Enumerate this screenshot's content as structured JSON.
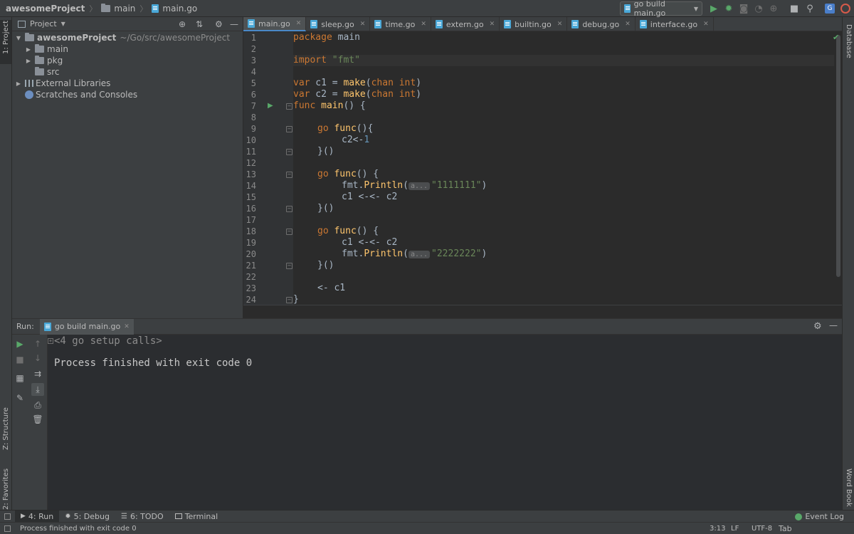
{
  "navbar": {
    "project": "awesomeProject",
    "folder": "main",
    "file": "main.go"
  },
  "run_config": {
    "label": "go build main.go"
  },
  "left_stripe": {
    "project_label": "1: Project",
    "structure_label": "Z: Structure",
    "favorites_label": "2: Favorites"
  },
  "right_stripe": {
    "database_label": "Database",
    "wordbook_label": "Word Book"
  },
  "project_panel": {
    "title": "Project",
    "tree": [
      {
        "label": "awesomeProject",
        "path": "~/Go/src/awesomeProject"
      },
      {
        "label": "main"
      },
      {
        "label": "pkg"
      },
      {
        "label": "src"
      },
      {
        "label": "External Libraries"
      },
      {
        "label": "Scratches and Consoles"
      }
    ]
  },
  "editor": {
    "tabs": [
      {
        "label": "main.go"
      },
      {
        "label": "sleep.go"
      },
      {
        "label": "time.go"
      },
      {
        "label": "extern.go"
      },
      {
        "label": "builtin.go"
      },
      {
        "label": "debug.go"
      },
      {
        "label": "interface.go"
      }
    ],
    "line_numbers": [
      "1",
      "2",
      "3",
      "4",
      "5",
      "6",
      "7",
      "8",
      "9",
      "10",
      "11",
      "12",
      "13",
      "14",
      "15",
      "16",
      "17",
      "18",
      "19",
      "20",
      "21",
      "22",
      "23",
      "24"
    ],
    "code": {
      "l1_kw": "package",
      "l1_rest": " main",
      "l3_kw": "import",
      "l3_str": "\"fmt\"",
      "l5_kw": "var",
      "l5_a": " c1 = ",
      "l5_fn": "make",
      "l5_b": "(",
      "l5_chan": "chan",
      "l5_int": " int",
      "l5_c": ")",
      "l6_kw": "var",
      "l6_a": " c2 = ",
      "l6_fn": "make",
      "l6_b": "(",
      "l6_chan": "chan",
      "l6_int": " int",
      "l6_c": ")",
      "l7_kw": "func",
      "l7_fn": " main",
      "l7_rest": "() {",
      "l9_kw": "go",
      "l9_fn": " func",
      "l9_rest": "(){",
      "l10_a": "c2<-",
      "l10_num": "1",
      "l11": "}()",
      "l13_kw": "go",
      "l13_fn": " func",
      "l13_rest": "() {",
      "l14_a": "fmt.",
      "l14_fn": "Println",
      "l14_b": "(",
      "l14_hint": "a...",
      "l14_str": "\"1111111\"",
      "l14_c": ")",
      "l15": "c1 <-<- c2",
      "l16": "}()",
      "l18_kw": "go",
      "l18_fn": " func",
      "l18_rest": "() {",
      "l19": "c1 <-<- c2",
      "l20_a": "fmt.",
      "l20_fn": "Println",
      "l20_b": "(",
      "l20_hint": "a...",
      "l20_str": "\"2222222\"",
      "l20_c": ")",
      "l21": "}()",
      "l23": "<- c1",
      "l24": "}"
    }
  },
  "run_panel": {
    "run_label": "Run:",
    "tab_label": "go build main.go",
    "console_line1": "<4 go setup calls>",
    "console_line2": "Process finished with exit code 0"
  },
  "bottom_tabs": {
    "run": "4: Run",
    "debug": "5: Debug",
    "todo": "6: TODO",
    "terminal": "Terminal",
    "event_log": "Event Log"
  },
  "status_bar": {
    "message": "Process finished with exit code 0",
    "position": "3:13",
    "line_sep": "LF",
    "encoding": "UTF-8",
    "indent": "Tab"
  },
  "colors": {
    "keyword": "#cc7832",
    "function": "#ffc66d",
    "string": "#6a8759",
    "number": "#6897bb",
    "run_green": "#59a869",
    "accent_blue": "#4a88c7"
  }
}
